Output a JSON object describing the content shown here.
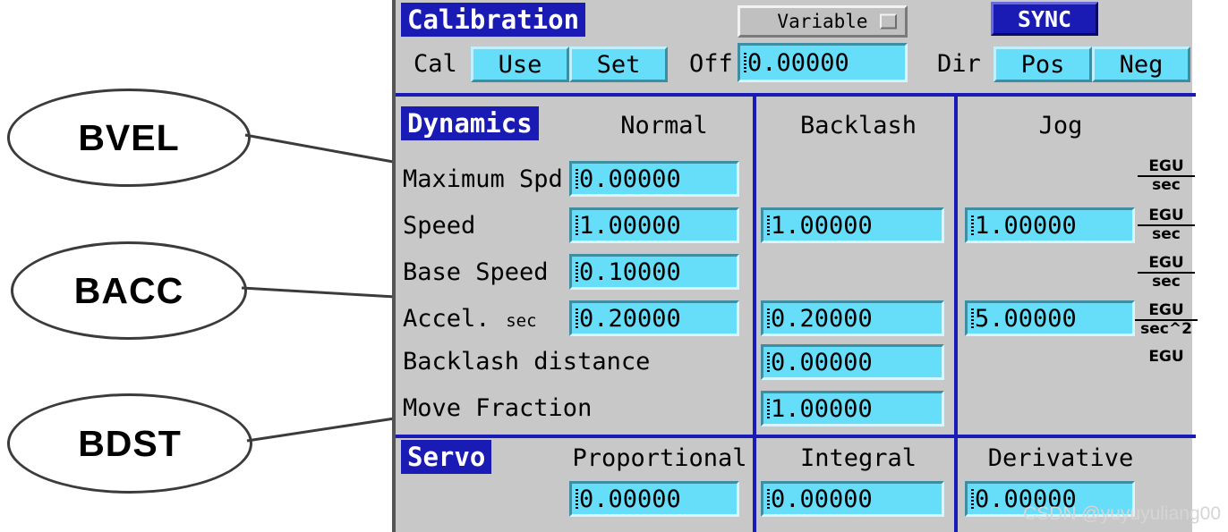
{
  "annotations": [
    {
      "label": "BVEL"
    },
    {
      "label": "BACC"
    },
    {
      "label": "BDST"
    }
  ],
  "panel": {
    "calibration": {
      "title": "Calibration",
      "cal_label": "Cal",
      "use_button": "Use",
      "set_button": "Set",
      "off_label": "Off",
      "off_value": "0.00000",
      "variable_menu": "Variable",
      "sync_button": "SYNC",
      "dir_label": "Dir",
      "pos_button": "Pos",
      "neg_button": "Neg"
    },
    "dynamics": {
      "title": "Dynamics",
      "columns": [
        "Normal",
        "Backlash",
        "Jog"
      ],
      "rows": [
        {
          "label": "Maximum Spd",
          "normal": "0.00000",
          "backlash": "",
          "jog": "",
          "egu_num": "EGU",
          "egu_den": "sec"
        },
        {
          "label": "Speed",
          "normal": "1.00000",
          "backlash": "1.00000",
          "jog": "1.00000",
          "egu_num": "EGU",
          "egu_den": "sec"
        },
        {
          "label": "Base Speed",
          "normal": "0.10000",
          "backlash": "",
          "jog": "",
          "egu_num": "EGU",
          "egu_den": "sec"
        },
        {
          "label": "Accel.",
          "label_sub": "sec",
          "normal": "0.20000",
          "backlash": "0.20000",
          "jog": "5.00000",
          "egu_num": "EGU",
          "egu_den": "sec^2"
        },
        {
          "label": "Backlash distance",
          "normal": "",
          "backlash": "0.00000",
          "jog": "",
          "egu_num": "EGU",
          "egu_den": ""
        },
        {
          "label": "Move Fraction",
          "normal": "",
          "backlash": "1.00000",
          "jog": "",
          "egu_num": "",
          "egu_den": ""
        }
      ]
    },
    "servo": {
      "title": "Servo",
      "columns": [
        "Proportional",
        "Integral",
        "Derivative"
      ],
      "values": [
        "0.00000",
        "0.00000",
        "0.00000"
      ]
    }
  },
  "watermark": "CSDN @yuyuyuliang00",
  "colors": {
    "panel_bg": "#c8c8c8",
    "accent_blue": "#1a1ab4",
    "field_cyan": "#66ddf9"
  }
}
